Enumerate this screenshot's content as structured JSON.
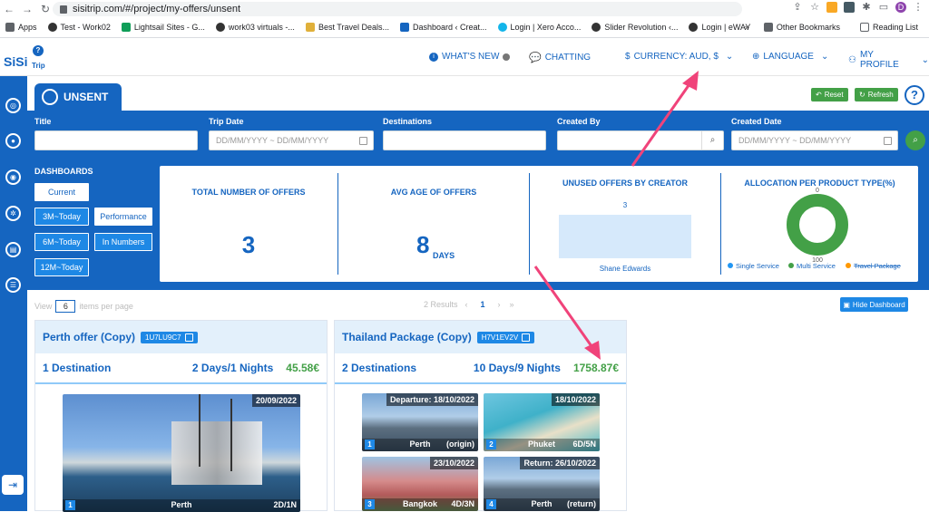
{
  "browser": {
    "url": "sisitrip.com/#/project/my-offers/unsent",
    "bookmarks": [
      "Apps",
      "Test - Work02",
      "Lightsail Sites - G...",
      "work03 virtuals -...",
      "Best Travel Deals...",
      "Dashboard ‹ Creat...",
      "Login | Xero Acco...",
      "Slider Revolution ‹...",
      "Login | eWAY"
    ],
    "overflow_label": "»",
    "other_bookmarks": "Other Bookmarks",
    "reading_list": "Reading List",
    "profile_initial": "D"
  },
  "header": {
    "logo_main": "SiSi",
    "logo_sub": "Trip",
    "logo_pin": "?",
    "whats_new": "WHAT'S NEW",
    "chatting": "CHATTING",
    "currency": "CURRENCY: AUD, $",
    "language": "LANGUAGE",
    "profile": "MY PROFILE"
  },
  "page": {
    "tab_label": "UNSENT",
    "reset_label": "Reset",
    "refresh_label": "Refresh",
    "help_label": "?"
  },
  "filters": {
    "title_label": "Title",
    "trip_date_label": "Trip Date",
    "trip_date_placeholder": "DD/MM/YYYY ~ DD/MM/YYYY",
    "destinations_label": "Destinations",
    "created_by_label": "Created By",
    "created_date_label": "Created Date",
    "created_date_placeholder": "DD/MM/YYYY ~ DD/MM/YYYY"
  },
  "dashboards": {
    "title": "DASHBOARDS",
    "periods": [
      "Current",
      "3M~Today",
      "6M~Today",
      "12M~Today"
    ],
    "views": [
      "Performance",
      "In Numbers"
    ]
  },
  "stats": {
    "total_title": "TOTAL NUMBER OF OFFERS",
    "total_value": "3",
    "avg_title": "AVG AGE OF OFFERS",
    "avg_value": "8",
    "avg_unit": "DAYS",
    "unused_title": "UNUSED OFFERS BY CREATOR",
    "allocation_title": "ALLOCATION PER PRODUCT TYPE(%)"
  },
  "chart_data": [
    {
      "type": "bar",
      "title": "UNUSED OFFERS BY CREATOR",
      "categories": [
        "Shane Edwards"
      ],
      "values": [
        3
      ],
      "data_labels": [
        "3"
      ],
      "color": "#d6e9fb"
    },
    {
      "type": "pie",
      "title": "ALLOCATION PER PRODUCT TYPE(%)",
      "donut": true,
      "labels": [
        "Single Service",
        "Multi Service",
        "Travel Package"
      ],
      "values": [
        0,
        100,
        0
      ],
      "colors": [
        "#2196f3",
        "#43a047",
        "#ff9800"
      ],
      "data_labels": [
        "0",
        "100"
      ],
      "legend_position": "bottom",
      "legend_struck": [
        "Travel Package"
      ]
    }
  ],
  "pagination": {
    "view_label": "View",
    "per_page_value": "6",
    "per_page_suffix": "items per page",
    "results": "2 Results",
    "current_page": "1",
    "hide_dashboard": "Hide Dashboard"
  },
  "cards": [
    {
      "name": "Perth offer (Copy)",
      "code": "1U7LU9C7",
      "destinations": "1 Destination",
      "duration": "2 Days/1 Nights",
      "price": "45.58€",
      "photos": [
        {
          "date": "20/09/2022",
          "index": "1",
          "city": "Perth",
          "right": "2D/1N"
        }
      ]
    },
    {
      "name": "Thailand Package (Copy)",
      "code": "H7V1EV2V",
      "destinations": "2 Destinations",
      "duration": "10 Days/9 Nights",
      "price": "1758.87€",
      "photos": [
        {
          "date": "Departure: 18/10/2022",
          "index": "1",
          "city": "Perth",
          "right": "(origin)"
        },
        {
          "date": "18/10/2022",
          "index": "2",
          "city": "Phuket",
          "right": "6D/5N"
        },
        {
          "date": "23/10/2022",
          "index": "3",
          "city": "Bangkok",
          "right": "4D/3N"
        },
        {
          "date": "Return: 26/10/2022",
          "index": "4",
          "city": "Perth",
          "right": "(return)"
        }
      ]
    }
  ],
  "colors": {
    "brand": "#1565c0",
    "accent": "#1e88e5",
    "success": "#43a047",
    "annotation_arrow": "#f0437a"
  }
}
